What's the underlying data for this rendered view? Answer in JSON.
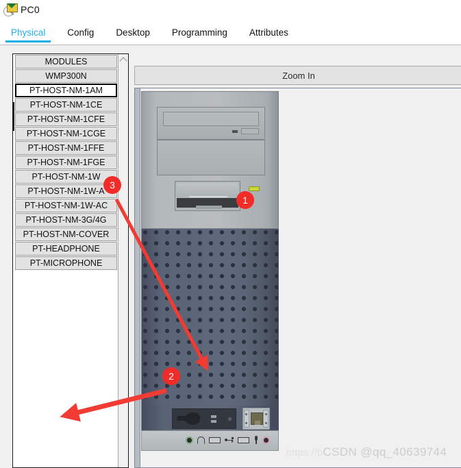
{
  "window": {
    "title": "PC0",
    "icon": "magnifier-envelope-icon"
  },
  "tabs": [
    {
      "label": "Physical",
      "active": true
    },
    {
      "label": "Config",
      "active": false
    },
    {
      "label": "Desktop",
      "active": false
    },
    {
      "label": "Programming",
      "active": false
    },
    {
      "label": "Attributes",
      "active": false
    }
  ],
  "modules": {
    "header": "MODULES",
    "items": [
      {
        "label": "MODULES",
        "selected": false,
        "is_header": true
      },
      {
        "label": "WMP300N",
        "selected": false
      },
      {
        "label": "PT-HOST-NM-1AM",
        "selected": true
      },
      {
        "label": "PT-HOST-NM-1CE",
        "selected": false
      },
      {
        "label": "PT-HOST-NM-1CFE",
        "selected": false
      },
      {
        "label": "PT-HOST-NM-1CGE",
        "selected": false
      },
      {
        "label": "PT-HOST-NM-1FFE",
        "selected": false
      },
      {
        "label": "PT-HOST-NM-1FGE",
        "selected": false
      },
      {
        "label": "PT-HOST-NM-1W",
        "selected": false
      },
      {
        "label": "PT-HOST-NM-1W-A",
        "selected": false
      },
      {
        "label": "PT-HOST-NM-1W-AC",
        "selected": false
      },
      {
        "label": "PT-HOST-NM-3G/4G",
        "selected": false
      },
      {
        "label": "PT-HOST-NM-COVER",
        "selected": false
      },
      {
        "label": "PT-HEADPHONE",
        "selected": false
      },
      {
        "label": "PT-MICROPHONE",
        "selected": false
      }
    ]
  },
  "viewer": {
    "zoom_label": "Zoom In",
    "device": "pc-tower-front-view"
  },
  "annotations": [
    {
      "id": "1",
      "label": "1",
      "target": "power-led-indicator"
    },
    {
      "id": "2",
      "label": "2",
      "target": "rear-io-module-slot"
    },
    {
      "id": "3",
      "label": "3",
      "target": "module-list-item"
    }
  ],
  "watermark": {
    "url": "https://b",
    "text": "CSDN @qq_40639744"
  },
  "colors": {
    "accent": "#18aee6",
    "badge": "#f02b28",
    "arrow": "#f23b32",
    "panel_bg": "#f0f0f0",
    "module_bg": "#e2e2e2"
  }
}
